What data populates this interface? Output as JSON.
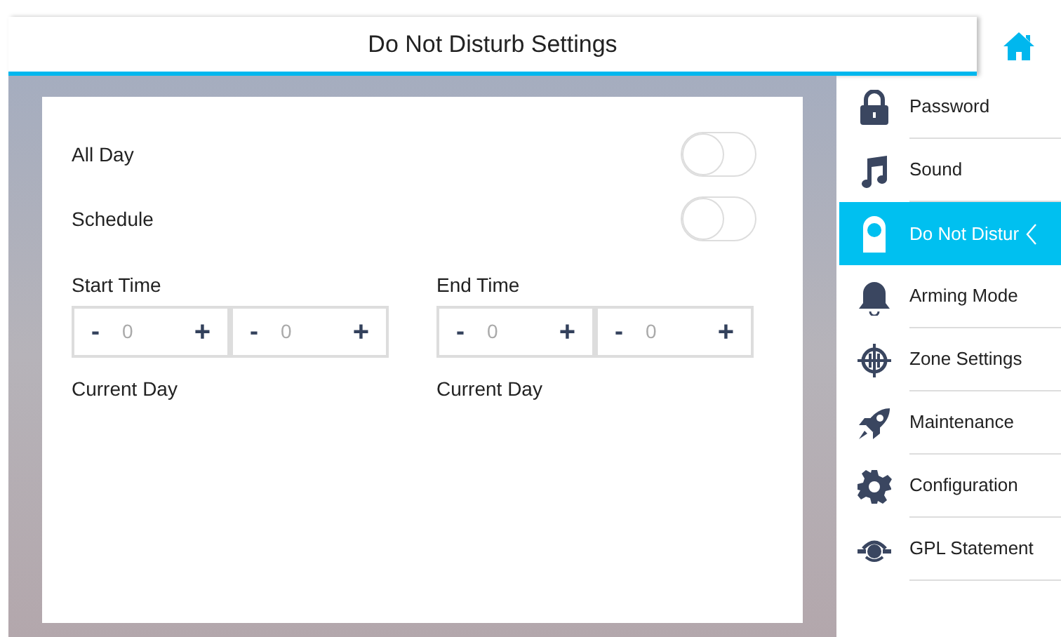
{
  "header": {
    "title": "Do Not Disturb Settings"
  },
  "settings": {
    "toggles": [
      {
        "label": "All Day",
        "on": false
      },
      {
        "label": "Schedule",
        "on": false
      }
    ],
    "times": [
      {
        "label": "Start Time",
        "steppers": [
          {
            "minus": "-",
            "value": "0",
            "plus": "+"
          },
          {
            "minus": "-",
            "value": "0",
            "plus": "+"
          }
        ],
        "day": "Current Day"
      },
      {
        "label": "End Time",
        "steppers": [
          {
            "minus": "-",
            "value": "0",
            "plus": "+"
          },
          {
            "minus": "-",
            "value": "0",
            "plus": "+"
          }
        ],
        "day": "Current Day"
      }
    ]
  },
  "sidebar": {
    "items": [
      {
        "label": "Password",
        "kind": "lock",
        "selected": false
      },
      {
        "label": "Sound",
        "kind": "music",
        "selected": false
      },
      {
        "label": "Do Not Distur",
        "kind": "dnd",
        "selected": true
      },
      {
        "label": "Arming Mode",
        "kind": "bell",
        "selected": false
      },
      {
        "label": "Zone Settings",
        "kind": "target",
        "selected": false
      },
      {
        "label": "Maintenance",
        "kind": "rocket",
        "selected": false
      },
      {
        "label": "Configuration",
        "kind": "gear",
        "selected": false
      },
      {
        "label": "GPL Statement",
        "kind": "eye",
        "selected": false
      }
    ]
  }
}
